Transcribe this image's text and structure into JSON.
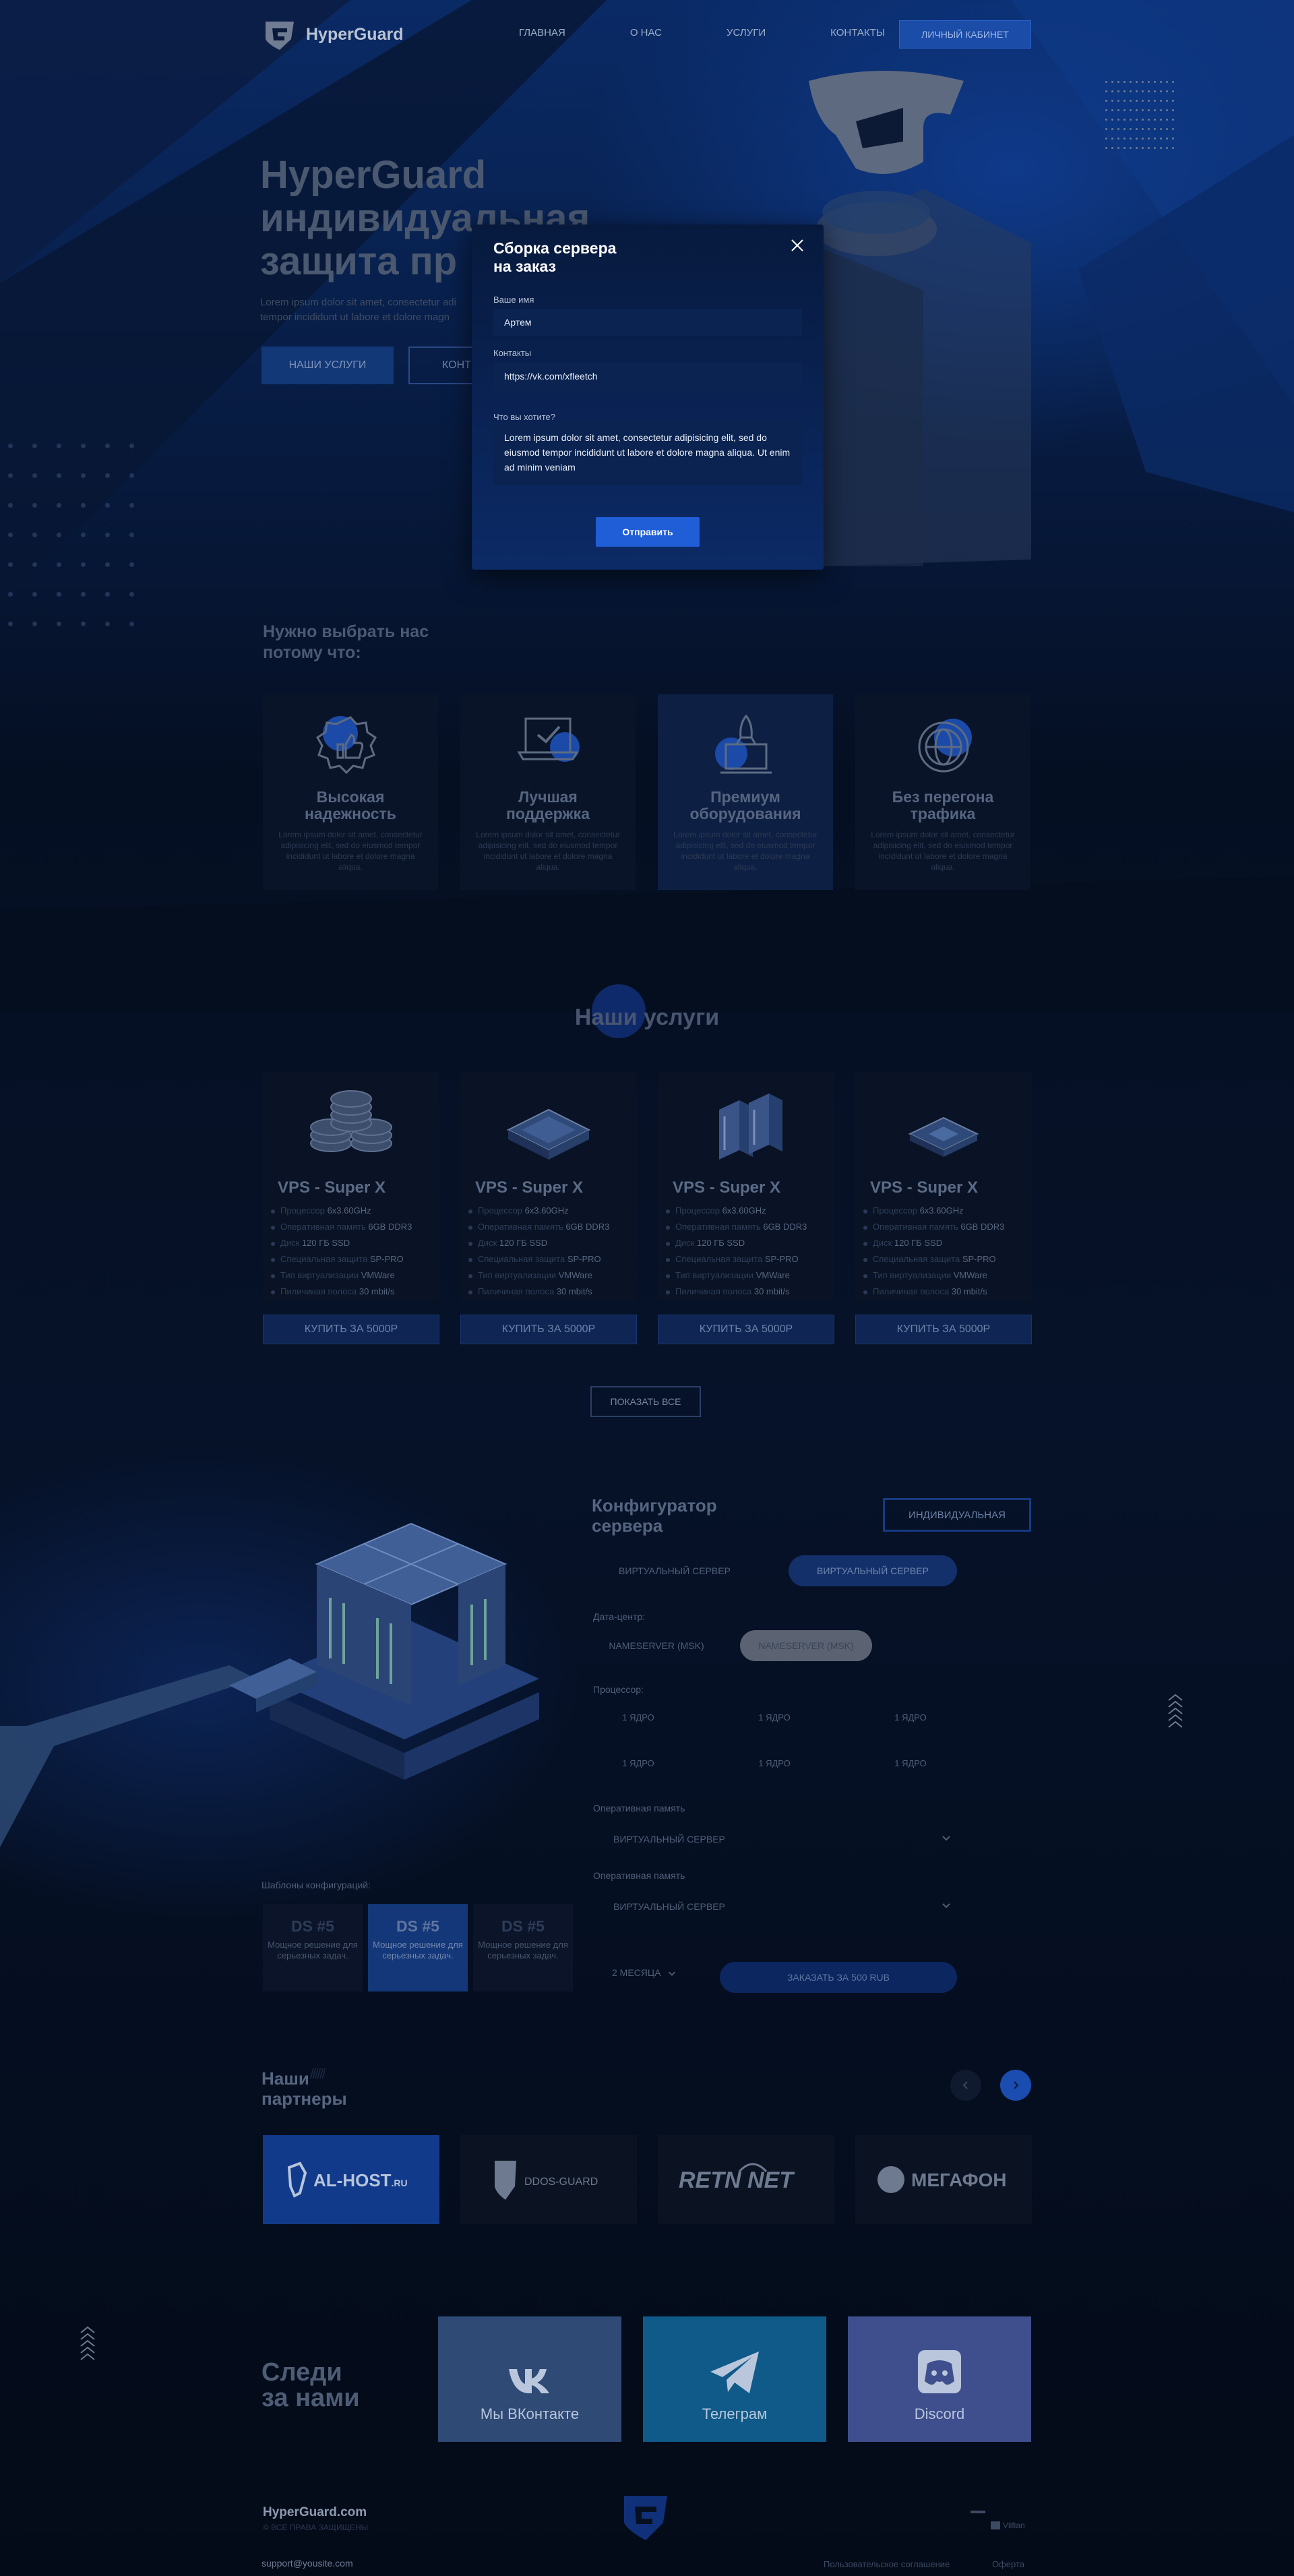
{
  "brand": {
    "name": "HyperGuard",
    "accent": "#1f5ed6",
    "bg": "#06101f"
  },
  "nav": {
    "items": [
      "ГЛАВНАЯ",
      "О НАС",
      "УСЛУГИ",
      "КОНТАКТЫ"
    ],
    "cabinet_label": "ЛИЧНЫЙ КАБИНЕТ"
  },
  "hero": {
    "title_l1": "HyperGuard",
    "title_l2": "индивидуальная",
    "title_l3": "защита пр",
    "text": "Lorem ipsum dolor sit amet, consectetur adi tempor incididunt ut labore et dolore magn",
    "btn_services": "НАШИ УСЛУГИ",
    "btn_contacts": "КОНТ"
  },
  "modal": {
    "title_l1": "Сборка сервера",
    "title_l2": "на заказ",
    "name_label": "Ваше имя",
    "name_value": "Артем",
    "contacts_label": "Контакты",
    "contacts_value": "https://vk.com/xfleetch",
    "wish_label": "Что вы хотите?",
    "wish_value": "Lorem ipsum dolor sit amet, consectetur adipisicing elit, sed do eiusmod tempor incididunt ut labore et dolore magna aliqua. Ut enim ad minim veniam",
    "submit_label": "Отправить",
    "close_icon": "close-icon"
  },
  "why": {
    "title_l1": "Нужно выбрать нас",
    "title_l2": "потому что:",
    "cards": [
      {
        "h1": "Высокая",
        "h2": "надежность",
        "icon": "badge-thumbs-up-icon",
        "desc": "Lorem ipsum dolor sit amet, consectetur adipisicing elit, sed do eiusmod tempor incididunt ut labore et dolore magna aliqua."
      },
      {
        "h1": "Лучшая",
        "h2": "поддержка",
        "icon": "laptop-check-icon",
        "desc": "Lorem ipsum dolor sit amet, consectetur adipisicing elit, sed do eiusmod tempor incididunt ut labore et dolore magna aliqua."
      },
      {
        "h1": "Премиум",
        "h2": "оборудования",
        "icon": "rocket-laptop-icon",
        "desc": "Lorem ipsum dolor sit amet, consectetur adipisicing elit, sed do eiusmod tempor incididunt ut labore et dolore magna aliqua."
      },
      {
        "h1": "Без перегона",
        "h2": "трафика",
        "icon": "globe-icon",
        "desc": "Lorem ipsum dolor sit amet, consectetur adipisicing elit, sed do eiusmod tempor incididunt ut labore et dolore magna aliqua."
      }
    ]
  },
  "services": {
    "title": "Наши услуги",
    "spec_labels": [
      "Процессор",
      "Оперативная память",
      "Диск",
      "Специальная защита",
      "Тип виртуализации",
      "Пиличиная полоса"
    ],
    "cards": [
      {
        "name": "VPS - Super X",
        "img": "disk-stack-icon",
        "specs": [
          "6x3.60GHz",
          "6GB DDR3",
          "120 ГБ SSD",
          "SP-PRO",
          "VMWare",
          "30 mbit/s"
        ],
        "buy": "КУПИТЬ ЗА 5000Р"
      },
      {
        "name": "VPS - Super X",
        "img": "server-box-icon",
        "specs": [
          "6x3.60GHz",
          "6GB DDR3",
          "120 ГБ SSD",
          "SP-PRO",
          "VMWare",
          "30 mbit/s"
        ],
        "buy": "КУПИТЬ ЗА 5000Р"
      },
      {
        "name": "VPS - Super X",
        "img": "server-towers-icon",
        "specs": [
          "6x3.60GHz",
          "6GB DDR3",
          "120 ГБ SSD",
          "SP-PRO",
          "VMWare",
          "30 mbit/s"
        ],
        "buy": "КУПИТЬ ЗА 5000Р"
      },
      {
        "name": "VPS - Super X",
        "img": "chip-board-icon",
        "specs": [
          "6x3.60GHz",
          "6GB DDR3",
          "120 ГБ SSD",
          "SP-PRO",
          "VMWare",
          "30 mbit/s"
        ],
        "buy": "КУПИТЬ ЗА 5000Р"
      }
    ],
    "show_all": "ПОКАЗАТЬ ВСЕ"
  },
  "config": {
    "title_l1": "Конфигуратор",
    "title_l2": "сервера",
    "individual": "ИНДИВИДУАЛЬНАЯ",
    "type_options": [
      "ВИРТУАЛЬНЫЙ СЕРВЕР",
      "ВИРТУАЛЬНЫЙ СЕРВЕР"
    ],
    "dc_label": "Дата-центр:",
    "dc_options": [
      "NAMESERVER (MSK)",
      "NAMESERVER (MSK)"
    ],
    "cpu_label": "Процессор:",
    "cpu_options": [
      "1 ЯДРО",
      "1 ЯДРО",
      "1 ЯДРО",
      "1 ЯДРО",
      "1 ЯДРО",
      "1 ЯДРО"
    ],
    "ram_label_1": "Оперативная память",
    "ram_value_1": "ВИРТУАЛЬНЫЙ СЕРВЕР",
    "ram_label_2": "Оперативная память",
    "ram_value_2": "ВИРТУАЛЬНЫЙ СЕРВЕР",
    "months": "2 МЕСЯЦА",
    "order": "ЗАКАЗАТЬ ЗА 500 RUB",
    "templates_label": "Шаблоны конфигураций:",
    "templates": [
      {
        "name": "DS #5",
        "desc": "Мощное решение для серьезных задач."
      },
      {
        "name": "DS #5",
        "desc": "Мощное решение для серьезных задач."
      },
      {
        "name": "DS #5",
        "desc": "Мощное решение для серьезных задач."
      }
    ]
  },
  "partners": {
    "title_l1": "Наши",
    "title_l2": "партнеры",
    "logos": [
      "AL-HOST.RU",
      "DDOS-GUARD",
      "RETN NET",
      "МЕГАФОН"
    ]
  },
  "follow": {
    "title_l1": "Следи",
    "title_l2": "за нами",
    "cards": [
      {
        "label": "Мы ВКонтакте",
        "icon": "vk-icon",
        "color": "#2e4a75"
      },
      {
        "label": "Телеграм",
        "icon": "telegram-icon",
        "color": "#0f5a88"
      },
      {
        "label": "Discord",
        "icon": "discord-icon",
        "color": "#3f4f8e"
      }
    ]
  },
  "footer": {
    "site": "HyperGuard.com",
    "copyright": "© ВСЕ ПРАВА ЗАЩИЩЕНЫ",
    "email": "support@yousite.com",
    "link_terms": "Пользовательское соглашение",
    "link_offer": "Оферта",
    "dev": "Vlifian"
  }
}
